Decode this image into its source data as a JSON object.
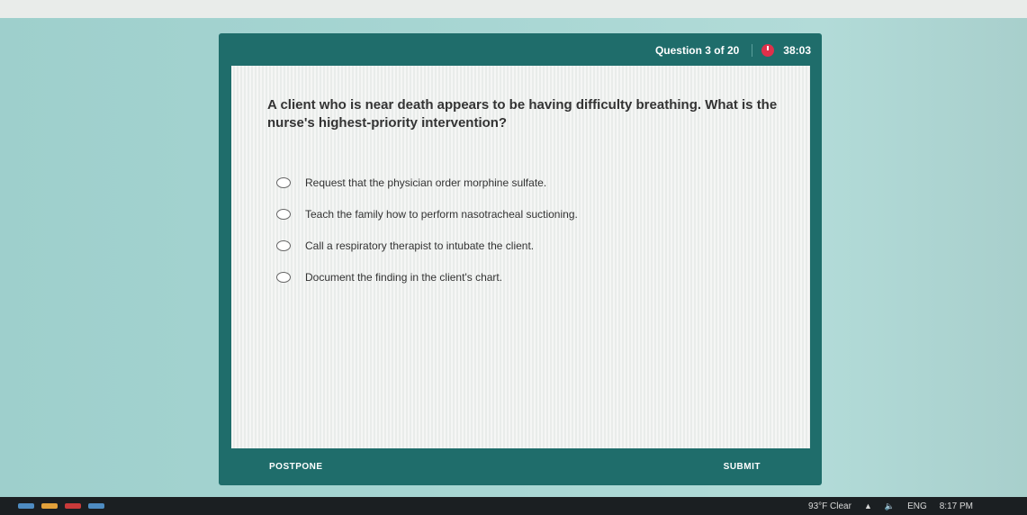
{
  "quiz": {
    "question_counter": "Question 3 of 20",
    "timer": "38:03",
    "question": "A client who is near death appears to be having difficulty breathing. What is the nurse's highest-priority intervention?",
    "options": [
      {
        "label": "Request that the physician order morphine sulfate."
      },
      {
        "label": "Teach the family how to perform nasotracheal suctioning."
      },
      {
        "label": "Call a respiratory therapist to intubate the client."
      },
      {
        "label": "Document the finding in the client's chart."
      }
    ],
    "postpone_label": "POSTPONE",
    "submit_label": "SUBMIT"
  },
  "taskbar": {
    "weather": "93°F  Clear",
    "language": "ENG",
    "time": "8:17 PM",
    "chevron_icon": "chevron-up-icon",
    "speaker_icon": "speaker-icon"
  },
  "colors": {
    "window_frame": "#1f6d6b",
    "timer_accent": "#e0304a",
    "desktop": "#a6d5d2"
  }
}
